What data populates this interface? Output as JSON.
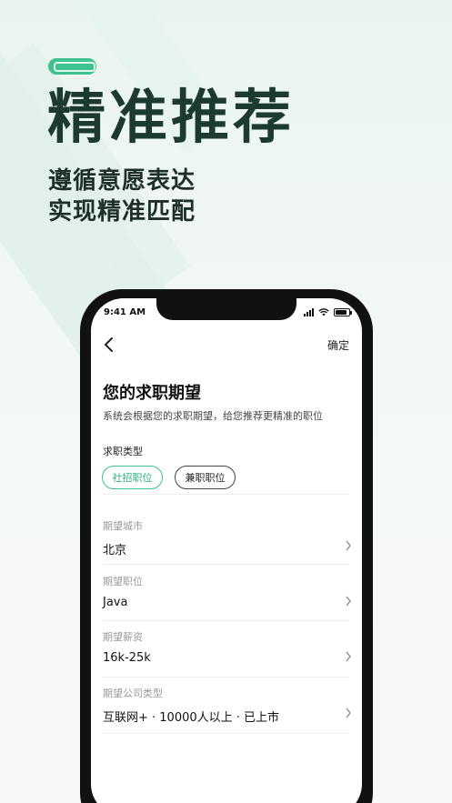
{
  "promo": {
    "headline": "精准推荐",
    "subline1": "遵循意愿表达",
    "subline2": "实现精准匹配",
    "accent": "#3fc28f"
  },
  "status_bar": {
    "time": "9:41 AM"
  },
  "nav": {
    "confirm_label": "确定"
  },
  "page": {
    "title": "您的求职期望",
    "description": "系统会根据您的求职期望，给您推荐更精准的职位"
  },
  "job_type": {
    "label": "求职类型",
    "options": [
      "社招职位",
      "兼职职位"
    ],
    "selected": "社招职位"
  },
  "fields": [
    {
      "label": "期望城市",
      "value": "北京"
    },
    {
      "label": "期望职位",
      "value": "Java"
    },
    {
      "label": "期望薪资",
      "value": "16k-25k"
    },
    {
      "label": "期望公司类型",
      "value": "互联网+ · 10000人以上 · 已上市"
    }
  ]
}
